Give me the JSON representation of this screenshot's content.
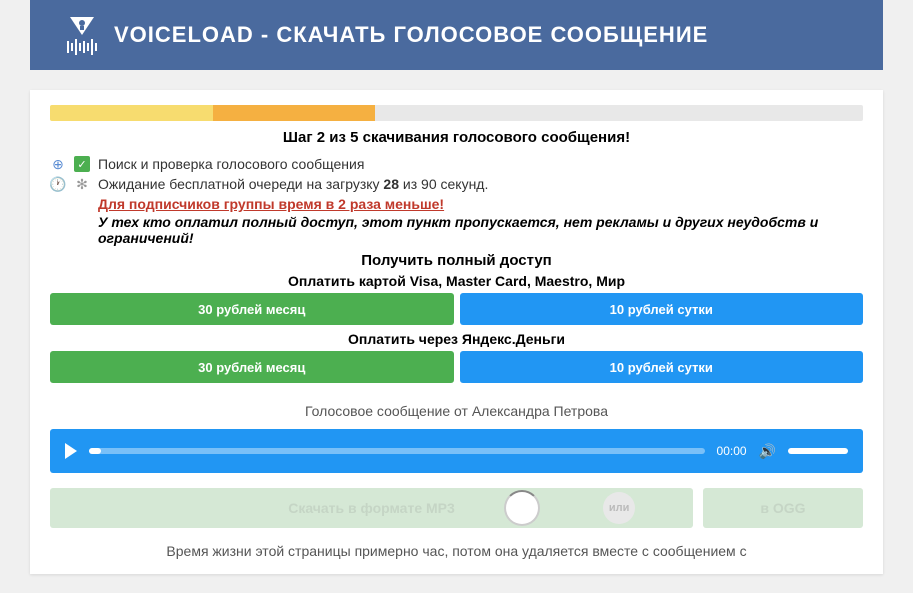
{
  "header": {
    "title": "VOICELOAD - СКАЧАТЬ ГОЛОСОВОЕ СООБЩЕНИЕ"
  },
  "step": {
    "title": "Шаг 2 из 5 скачивания голосового сообщения!"
  },
  "status": {
    "check_text": "Поиск и проверка голосового сообщения",
    "wait_prefix": "Ожидание бесплатной очереди на загрузку ",
    "wait_count": "28",
    "wait_mid": " из ",
    "wait_total": "90",
    "wait_suffix": " секунд.",
    "red_link": "Для подписчиков группы время в 2 раза меньше!",
    "italic_note": "У тех кто оплатил полный доступ, этот пункт пропускается, нет рекламы и других неудобств и ограничений!"
  },
  "access": {
    "title": "Получить полный доступ",
    "pay_card": "Оплатить картой Visa, Master Card, Maestro, Мир",
    "pay_yandex": "Оплатить через Яндекс.Деньги",
    "btn_month": "30 рублей месяц",
    "btn_day": "10 рублей сутки"
  },
  "voice": {
    "label": "Голосовое сообщение от Александра Петрова",
    "time": "00:00"
  },
  "download": {
    "mp3": "Скачать в формате MP3",
    "or": "или",
    "ogg": "в OGG"
  },
  "footer": {
    "text": "Время жизни этой страницы примерно час, потом она удаляется вместе с сообщением с"
  }
}
